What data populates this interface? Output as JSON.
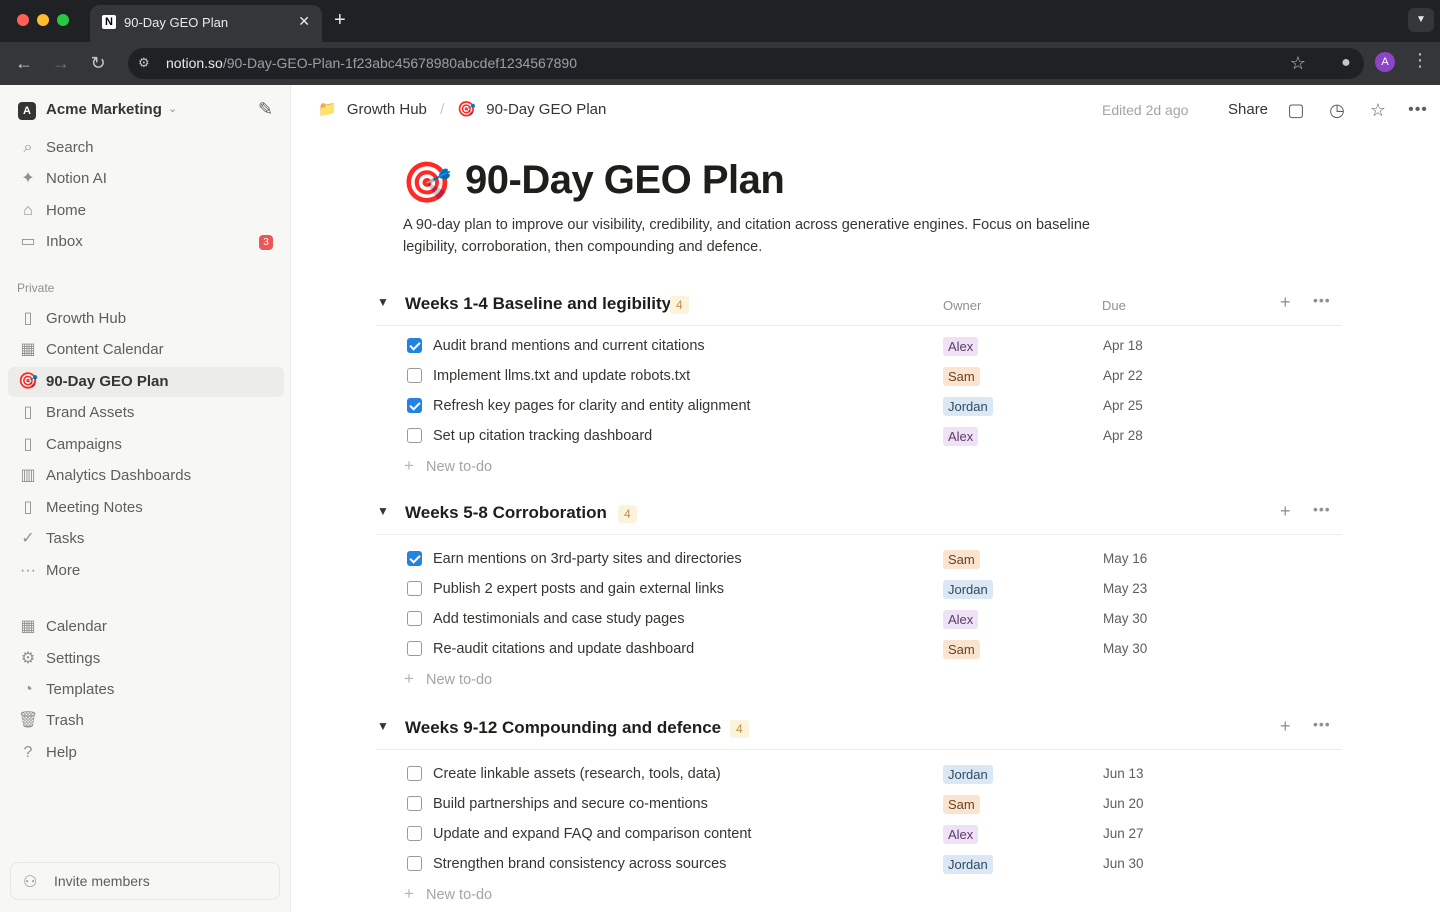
{
  "browser": {
    "tab_title": "90-Day GEO Plan",
    "tab_favicon": "N",
    "url_host": "notion.so",
    "url_path": "/90-Day-GEO-Plan-1f23abc45678980abcdef1234567890",
    "profile_initial": "A"
  },
  "sidebar": {
    "workspace": "Acme Marketing",
    "workspace_logo": "A",
    "top_items": [
      {
        "label": "Search",
        "icon": "search-icon"
      },
      {
        "label": "Notion AI",
        "icon": "notion-ai-icon"
      },
      {
        "label": "Home",
        "icon": "home-icon"
      },
      {
        "label": "Inbox",
        "icon": "inbox-icon",
        "badge": "3"
      }
    ],
    "section_label": "Private",
    "private_items": [
      {
        "label": "Growth Hub",
        "icon": "page-icon"
      },
      {
        "label": "Content Calendar",
        "icon": "calendar-icon"
      },
      {
        "label": "90-Day GEO Plan",
        "icon": "target-icon",
        "active": true
      },
      {
        "label": "Brand Assets",
        "icon": "page-icon"
      },
      {
        "label": "Campaigns",
        "icon": "page-icon"
      },
      {
        "label": "Analytics Dashboards",
        "icon": "chart-icon"
      },
      {
        "label": "Meeting Notes",
        "icon": "page-icon"
      },
      {
        "label": "Tasks",
        "icon": "check-icon"
      },
      {
        "label": "More",
        "icon": "more-icon"
      }
    ],
    "bottom_items": [
      {
        "label": "Calendar",
        "icon": "calendar-icon"
      },
      {
        "label": "Settings",
        "icon": "gear-icon"
      },
      {
        "label": "Templates",
        "icon": "templates-icon"
      },
      {
        "label": "Trash",
        "icon": "trash-icon"
      },
      {
        "label": "Help",
        "icon": "help-icon"
      }
    ],
    "invite_label": "Invite members"
  },
  "topbar": {
    "breadcrumb": [
      {
        "label": "Growth Hub",
        "emoji": "📁"
      },
      {
        "label": "90-Day GEO Plan",
        "emoji": "🎯"
      }
    ],
    "edited": "Edited 2d ago",
    "share": "Share"
  },
  "page": {
    "icon": "🎯",
    "title": "90-Day GEO Plan",
    "description": "A 90-day plan to improve our visibility, credibility, and citation across generative engines. Focus on baseline legibility, corroboration, then compounding and defence."
  },
  "groups": [
    {
      "title": "Weeks 1-4 Baseline and legibility",
      "count": "4",
      "show_columns": true,
      "owner_header": "Owner",
      "due_header": "Due",
      "tasks": [
        {
          "text": "Audit brand mentions and current citations",
          "done": true,
          "owner": "Alex",
          "due": "Apr 18"
        },
        {
          "text": "Implement llms.txt and update robots.txt",
          "done": false,
          "owner": "Sam",
          "due": "Apr 22"
        },
        {
          "text": "Refresh key pages for clarity and entity alignment",
          "done": true,
          "owner": "Jordan",
          "due": "Apr 25"
        },
        {
          "text": "Set up citation tracking dashboard",
          "done": false,
          "owner": "Alex",
          "due": "Apr 28"
        }
      ],
      "new_label": "New to-do"
    },
    {
      "title": "Weeks 5-8 Corroboration",
      "count": "4",
      "show_columns": false,
      "tasks": [
        {
          "text": "Earn mentions on 3rd-party sites and directories",
          "done": true,
          "owner": "Sam",
          "due": "May 16"
        },
        {
          "text": "Publish 2 expert posts and gain external links",
          "done": false,
          "owner": "Jordan",
          "due": "May 23"
        },
        {
          "text": "Add testimonials and case study pages",
          "done": false,
          "owner": "Alex",
          "due": "May 30"
        },
        {
          "text": "Re-audit citations and update dashboard",
          "done": false,
          "owner": "Sam",
          "due": "May 30"
        }
      ],
      "new_label": "New to-do"
    },
    {
      "title": "Weeks 9-12 Compounding and defence",
      "count": "4",
      "show_columns": false,
      "tasks": [
        {
          "text": "Create linkable assets (research, tools, data)",
          "done": false,
          "owner": "Jordan",
          "due": "Jun 13"
        },
        {
          "text": "Build partnerships and secure co-mentions",
          "done": false,
          "owner": "Sam",
          "due": "Jun 20"
        },
        {
          "text": "Update and expand FAQ and comparison content",
          "done": false,
          "owner": "Alex",
          "due": "Jun 27"
        },
        {
          "text": "Strengthen brand consistency across sources",
          "done": false,
          "owner": "Jordan",
          "due": "Jun 30"
        }
      ],
      "new_label": "New to-do"
    }
  ]
}
